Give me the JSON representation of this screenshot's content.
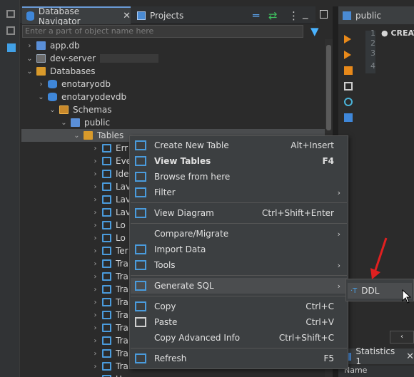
{
  "left_rail": {
    "icons": [
      "views-icon",
      "window-icon",
      "panel-icon"
    ]
  },
  "navigator": {
    "tabs": [
      {
        "label": "Database Navigator",
        "icon": "database-icon",
        "close": "✕"
      },
      {
        "label": "Projects",
        "icon": "projects-icon"
      }
    ],
    "filter_placeholder": "Enter a part of object name here",
    "tree": [
      {
        "label": "app.db",
        "level": 0,
        "expander": "›",
        "icon": "file"
      },
      {
        "label": "dev-server",
        "level": 0,
        "expander": "⌄",
        "icon": "server"
      },
      {
        "label": "Databases",
        "level": 1,
        "expander": "⌄",
        "icon": "folder"
      },
      {
        "label": "enotaryodb",
        "level": 2,
        "expander": "›",
        "icon": "db"
      },
      {
        "label": "enotaryodevdb",
        "level": 2,
        "expander": "⌄",
        "icon": "db"
      },
      {
        "label": "Schemas",
        "level": 3,
        "expander": "⌄",
        "icon": "schema"
      },
      {
        "label": "public",
        "level": 4,
        "expander": "⌄",
        "icon": "file"
      },
      {
        "label": "Tables",
        "level": 5,
        "expander": "⌄",
        "icon": "folder",
        "selected": true
      },
      {
        "label": "Err",
        "level": 6,
        "expander": "›",
        "icon": "table"
      },
      {
        "label": "Eve",
        "level": 6,
        "expander": "›",
        "icon": "table"
      },
      {
        "label": "Ide",
        "level": 6,
        "expander": "›",
        "icon": "table"
      },
      {
        "label": "Lav",
        "level": 6,
        "expander": "›",
        "icon": "table"
      },
      {
        "label": "Lav",
        "level": 6,
        "expander": "›",
        "icon": "table"
      },
      {
        "label": "Lav",
        "level": 6,
        "expander": "›",
        "icon": "table"
      },
      {
        "label": "Lo",
        "level": 6,
        "expander": "›",
        "icon": "table"
      },
      {
        "label": "Lo",
        "level": 6,
        "expander": "›",
        "icon": "table"
      },
      {
        "label": "Ter",
        "level": 6,
        "expander": "›",
        "icon": "table"
      },
      {
        "label": "Tra",
        "level": 6,
        "expander": "›",
        "icon": "table"
      },
      {
        "label": "Tra",
        "level": 6,
        "expander": "›",
        "icon": "table"
      },
      {
        "label": "Tra",
        "level": 6,
        "expander": "›",
        "icon": "table"
      },
      {
        "label": "Tra",
        "level": 6,
        "expander": "›",
        "icon": "table"
      },
      {
        "label": "Tra",
        "level": 6,
        "expander": "›",
        "icon": "table"
      },
      {
        "label": "Tra",
        "level": 6,
        "expander": "›",
        "icon": "table"
      },
      {
        "label": "Tra",
        "level": 6,
        "expander": "›",
        "icon": "table"
      },
      {
        "label": "Tra",
        "level": 6,
        "expander": "›",
        "icon": "table"
      },
      {
        "label": "Tra",
        "level": 6,
        "expander": "›",
        "icon": "table"
      },
      {
        "label": "Users",
        "level": 6,
        "expander": "›",
        "icon": "table"
      }
    ]
  },
  "editor": {
    "tab_label": "public",
    "line_numbers": [
      "1",
      "2",
      "3",
      "4"
    ],
    "code_fragment": "CREAT"
  },
  "statistics": {
    "tab_label": "Statistics 1",
    "close": "✕",
    "column_header": "Name",
    "scroll_left": "‹"
  },
  "context_menu": {
    "items": [
      {
        "label": "Create New Table",
        "shortcut": "Alt+Insert",
        "icon": "table-icon"
      },
      {
        "label": "View Tables",
        "shortcut": "F4",
        "icon": "edit-icon",
        "bold": true
      },
      {
        "label": "Browse from here",
        "shortcut": "",
        "icon": "browse-icon"
      },
      {
        "label": "Filter",
        "shortcut": "",
        "icon": "filter-icon",
        "submenu": true
      },
      {
        "separator": true
      },
      {
        "label": "View Diagram",
        "shortcut": "Ctrl+Shift+Enter",
        "icon": "diagram-icon"
      },
      {
        "separator": true
      },
      {
        "label": "Compare/Migrate",
        "shortcut": "",
        "icon": "",
        "submenu": true
      },
      {
        "label": "Import Data",
        "shortcut": "",
        "icon": "import-icon"
      },
      {
        "label": "Tools",
        "shortcut": "",
        "icon": "tools-icon",
        "submenu": true
      },
      {
        "separator": true
      },
      {
        "label": "Generate SQL",
        "shortcut": "",
        "icon": "sql-icon",
        "submenu": true,
        "highlighted": true
      },
      {
        "separator": true
      },
      {
        "label": "Copy",
        "shortcut": "Ctrl+C",
        "icon": "copy-icon"
      },
      {
        "label": "Paste",
        "shortcut": "Ctrl+V",
        "icon": "paste-icon"
      },
      {
        "label": "Copy Advanced Info",
        "shortcut": "Ctrl+Shift+C",
        "icon": ""
      },
      {
        "separator": true
      },
      {
        "label": "Refresh",
        "shortcut": "F5",
        "icon": "refresh-icon"
      }
    ],
    "submenu_arrow": "›"
  },
  "submenu": {
    "items": [
      {
        "label": "DDL",
        "icon": "ddl-icon",
        "icon_text": "·T"
      }
    ]
  },
  "colors": {
    "accent": "#4a9bdc",
    "selection": "#4b4d4f",
    "menu_bg": "#3c3f41",
    "annotation_arrow": "#e02020"
  }
}
